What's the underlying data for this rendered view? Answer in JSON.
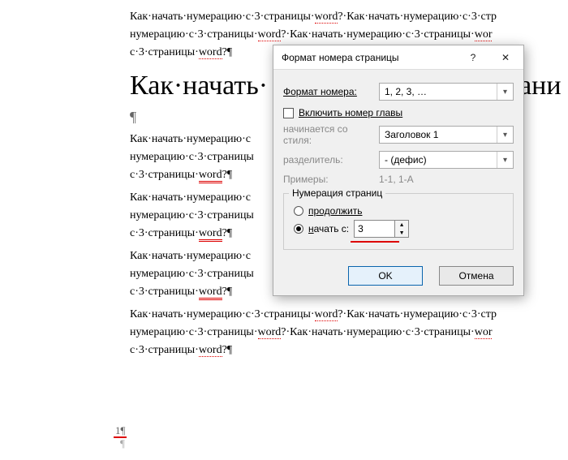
{
  "doc": {
    "para": "Как·начать·нумерацию·с·3·страницы·",
    "word": "word",
    "q": "?·",
    "para2": "Как·начать·нумерацию·с·3·стр",
    "line2a": "нумерацию·с·3·страницы·",
    "line2b": "?·Как·начать·нумерацию·с·3·страницы·",
    "line2c": "wor",
    "line3": "с·3·страницы·",
    "heading": "Как·начать·",
    "heading_tail": "ани",
    "pilcrow": "¶",
    "mid_a": "Как·начать·нумерацию·с",
    "mid_b": "нумерацию·с·3·страницы",
    "mid_c": "с·3·страницы·",
    "qshort": "?¶",
    "tail1": "·с·3·стр",
    "tail2": "ы·",
    "footer_num": "1¶"
  },
  "dialog": {
    "title": "Формат номера страницы",
    "help": "?",
    "close": "✕",
    "format_label": "Формат номера:",
    "format_value": "1, 2, 3, …",
    "include_chapter": "Включить номер главы",
    "starts_label": "начинается со стиля:",
    "starts_value": "Заголовок 1",
    "sep_label": "разделитель:",
    "sep_value": "-   (дефис)",
    "examples_label": "Примеры:",
    "examples_value": "1-1, 1-A",
    "group_title": "Нумерация страниц",
    "radio_continue": "продолжить",
    "radio_start": "начать с:",
    "start_value": "3",
    "ok": "OK",
    "cancel": "Отмена"
  }
}
